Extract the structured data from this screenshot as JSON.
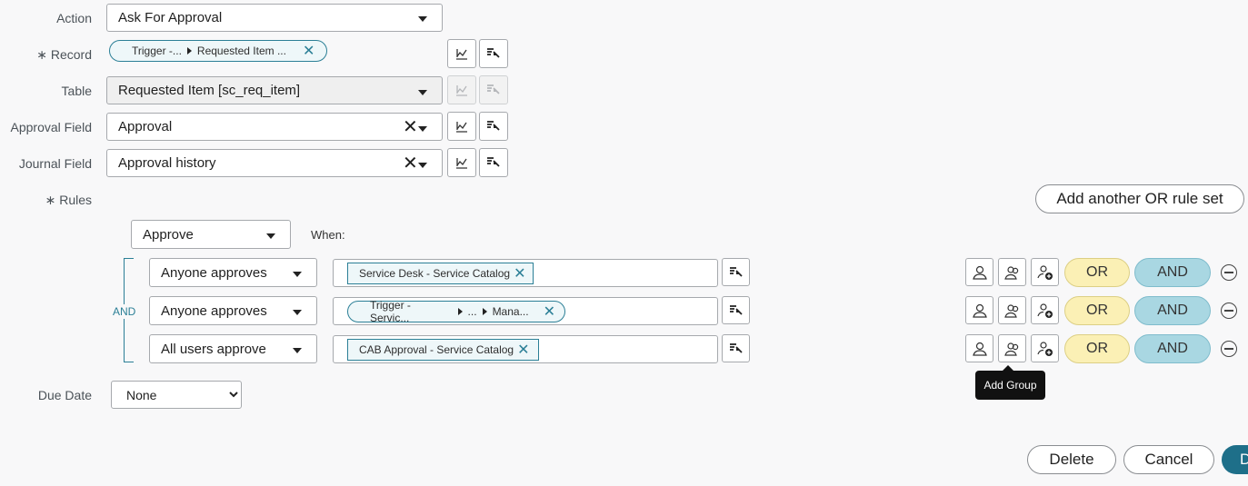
{
  "form": {
    "action": {
      "label": "Action",
      "value": "Ask For Approval"
    },
    "record": {
      "label": "Record",
      "required_mark": "∗",
      "pill_part1": "Trigger -...",
      "pill_part2": "Requested Item ..."
    },
    "table": {
      "label": "Table",
      "value": "Requested Item [sc_req_item]"
    },
    "approval_field": {
      "label": "Approval Field",
      "value": "Approval"
    },
    "journal_field": {
      "label": "Journal Field",
      "value": "Approval history"
    },
    "rules": {
      "label": "Rules",
      "required_mark": "∗"
    },
    "due_date": {
      "label": "Due Date",
      "value": "None",
      "options": [
        "None"
      ]
    }
  },
  "rules_section": {
    "add_or_button": "Add another OR rule set",
    "decision": "Approve",
    "when_label": "When:",
    "group_operator": "AND",
    "rows": [
      {
        "condition": "Anyone approves",
        "tag": "Service Desk - Service Catalog"
      },
      {
        "condition": "Anyone approves",
        "pill_parts": [
          "Trigger - Servic...",
          "...",
          "Mana..."
        ]
      },
      {
        "condition": "All users approve",
        "tag": "CAB Approval - Service Catalog"
      }
    ],
    "or_label": "OR",
    "and_label": "AND"
  },
  "tooltip": "Add Group",
  "footer": {
    "delete": "Delete",
    "cancel": "Cancel",
    "done_partial": "D"
  },
  "colors": {
    "teal": "#2b7f96",
    "or_bg": "#fbf0b5",
    "and_bg": "#a9d7e2",
    "primary": "#1e6f89"
  },
  "icons": {
    "data_pill_picker": "data-pill-picker-icon",
    "script_toggle": "script-toggle-icon",
    "add_user": "user-icon",
    "add_users": "users-icon",
    "add_group": "group-add-icon",
    "remove": "minus-circle-icon"
  }
}
